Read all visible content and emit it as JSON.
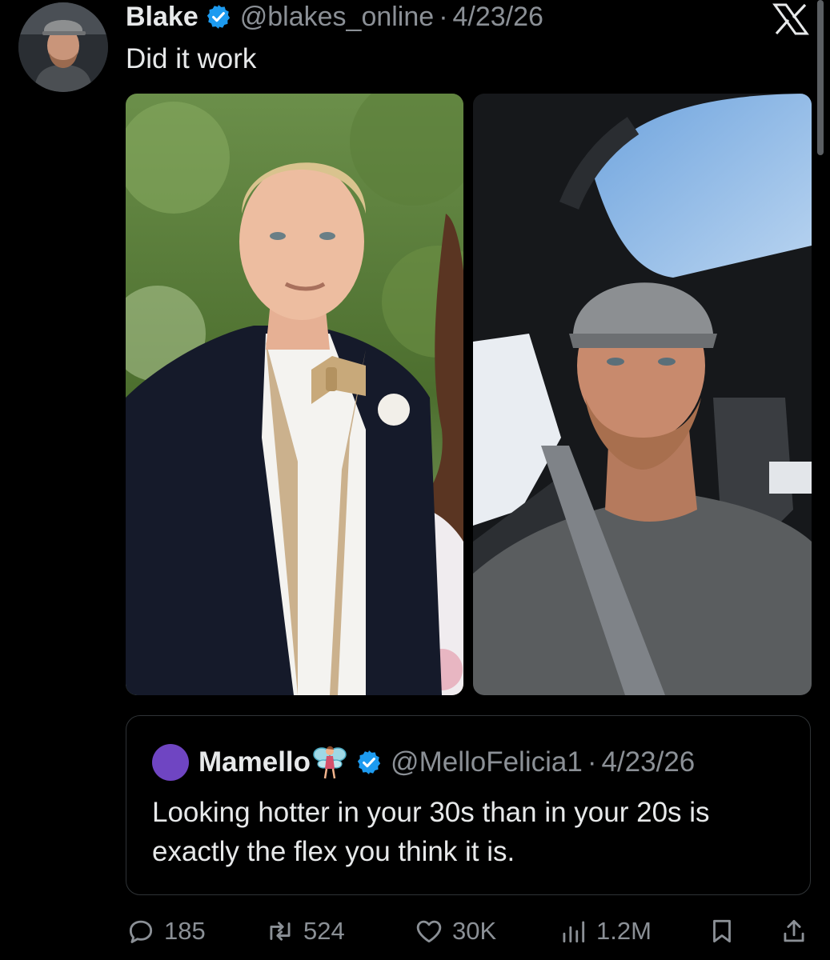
{
  "tweet": {
    "author_name": "Blake",
    "author_handle": "@blakes_online",
    "separator": "·",
    "date": "4/23/26",
    "text": "Did it work",
    "avatar": "profile-photo",
    "verified_icon": "verified-badge-icon",
    "platform_logo": "x-logo-icon"
  },
  "images": [
    {
      "name": "wedding-photo",
      "description_icon": "photo"
    },
    {
      "name": "car-selfie-photo",
      "description_icon": "photo"
    }
  ],
  "quote": {
    "author_name": "Mamello",
    "emoji_icon": "fairy-emoji-icon",
    "author_handle": "@MelloFelicia1",
    "separator": "·",
    "date": "4/23/26",
    "text": "Looking hotter in your 30s than in your 20s is exactly the flex you think it is.",
    "avatar_color": "#6f45c2"
  },
  "actions": {
    "reply_count": "185",
    "repost_count": "524",
    "like_count": "30K",
    "view_count": "1.2M",
    "icons": [
      "reply-icon",
      "repost-icon",
      "like-icon",
      "views-icon",
      "bookmark-icon",
      "share-icon"
    ]
  },
  "colors": {
    "background": "#000000",
    "text": "#e7e9ea",
    "secondary_text": "#8b9096",
    "verified_blue": "#1d9bf0",
    "border": "#2f3336"
  }
}
